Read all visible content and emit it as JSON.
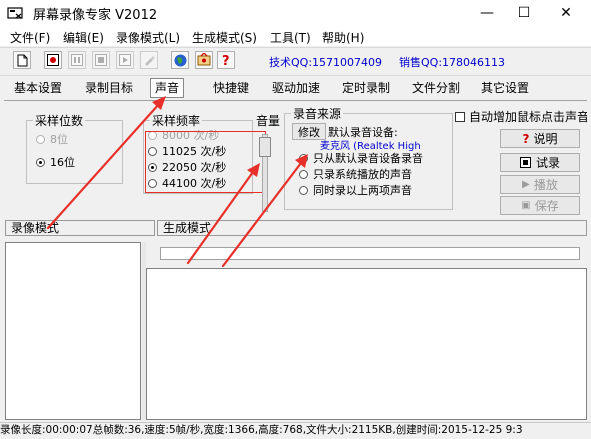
{
  "window": {
    "title": "屏幕录像专家 V2012",
    "minimize": "—",
    "maximize": "☐",
    "close": "✕"
  },
  "menu": [
    "文件(F)",
    "编辑(E)",
    "录像模式(L)",
    "生成模式(S)",
    "工具(T)",
    "帮助(H)"
  ],
  "toolbar": {
    "icons": [
      "new-document-icon",
      "record-icon",
      "pause-icon",
      "stop-icon",
      "play-icon",
      "pen-icon",
      "globe-icon",
      "settings-icon",
      "help-icon"
    ],
    "tech_qq": "技术QQ:1571007409",
    "sales_qq": "销售QQ:178046113"
  },
  "tabs": [
    "基本设置",
    "录制目标",
    "声音",
    "快捷键",
    "驱动加速",
    "定时录制",
    "文件分割",
    "其它设置"
  ],
  "sampling_bits": {
    "label": "采样位数",
    "options": [
      "8位",
      "16位"
    ]
  },
  "sampling_rate": {
    "label": "采样频率",
    "options": [
      "8000 次/秒",
      "11025 次/秒",
      "22050 次/秒",
      "44100 次/秒"
    ]
  },
  "volume": {
    "label": "音量"
  },
  "source": {
    "label": "录音来源",
    "modify_button": "修改",
    "default_device_label": "默认录音设备:",
    "device_name": "麦克风 (Realtek High",
    "options": [
      "只从默认录音设备录音",
      "只录系统播放的声音",
      "同时录以上两项声音"
    ]
  },
  "auto_cursor": {
    "label": "自动增加鼠标点击声音"
  },
  "actions": {
    "help": "说明",
    "test_record": "试录",
    "play": "播放",
    "save": "保存"
  },
  "sections": {
    "record_mode": "录像模式",
    "generate_mode": "生成模式"
  },
  "status": "录像长度:00:00:07总帧数:36,速度:5帧/秒,宽度:1366,高度:768,文件大小:2115KB,创建时间:2015-12-25 9:3",
  "colors": {
    "annotation_red": "#e8302a",
    "link_blue": "#0000cc"
  }
}
